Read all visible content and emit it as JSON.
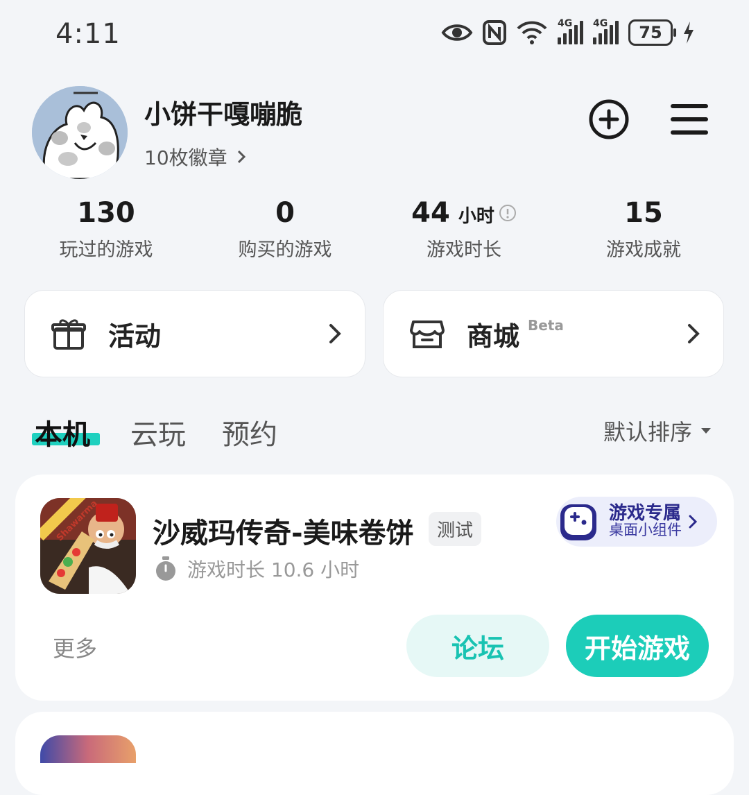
{
  "status_bar": {
    "time": "4:11",
    "battery": "75",
    "network_label": "4G"
  },
  "profile": {
    "username": "小饼干嘎嘣脆",
    "badges": "10枚徽章"
  },
  "stats": [
    {
      "value": "130",
      "unit": "",
      "label": "玩过的游戏"
    },
    {
      "value": "0",
      "unit": "",
      "label": "购买的游戏"
    },
    {
      "value": "44",
      "unit": "小时",
      "label": "游戏时长"
    },
    {
      "value": "15",
      "unit": "",
      "label": "游戏成就"
    }
  ],
  "entries": {
    "activity": {
      "label": "活动"
    },
    "store": {
      "label": "商城",
      "badge": "Beta"
    }
  },
  "tabs": [
    {
      "label": "本机",
      "active": true
    },
    {
      "label": "云玩",
      "active": false
    },
    {
      "label": "预约",
      "active": false
    }
  ],
  "sort": {
    "label": "默认排序"
  },
  "games": [
    {
      "title": "沙威玛传奇-美味卷饼",
      "tag": "测试",
      "playtime": "游戏时长 10.6 小时",
      "icon_label": "Shawarma",
      "widget_title": "游戏专属",
      "widget_subtitle": "桌面小组件",
      "more_label": "更多",
      "forum_label": "论坛",
      "start_label": "开始游戏"
    }
  ],
  "colors": {
    "accent": "#1ccdb9",
    "accent_light": "#e6f8f6",
    "widget_bg": "#eceefb",
    "widget_text": "#2b2a8c"
  }
}
